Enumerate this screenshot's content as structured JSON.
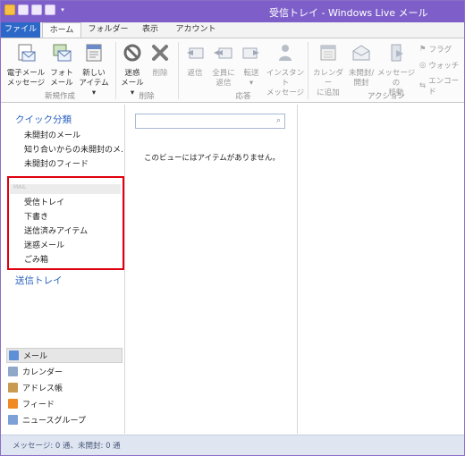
{
  "window": {
    "title": "受信トレイ - Windows Live メール"
  },
  "quick_access": {
    "caret": "▾"
  },
  "tabs": [
    {
      "label": "ファイル"
    },
    {
      "label": "ホーム"
    },
    {
      "label": "フォルダー"
    },
    {
      "label": "表示"
    },
    {
      "label": "アカウント"
    }
  ],
  "ribbon": {
    "new": {
      "email": [
        "電子メール",
        "メッセージ"
      ],
      "photo": [
        "フォト",
        "メール"
      ],
      "items": [
        "新しい",
        "アイテム ▾"
      ],
      "group": "新規作成"
    },
    "delete": {
      "junk": [
        "迷惑",
        "メール ▾"
      ],
      "delete": "削除",
      "group": "削除"
    },
    "respond": {
      "reply": "返信",
      "reply_all": [
        "全員に",
        "返信"
      ],
      "forward": [
        "転送",
        "▾"
      ],
      "instant": [
        "インスタント",
        "メッセージ"
      ],
      "group": "応答"
    },
    "actions": {
      "calendar": [
        "カレンダー",
        "に追加"
      ],
      "unread": [
        "未開封/",
        "開封"
      ],
      "move": [
        "メッセージの",
        "移動"
      ],
      "flag": "フラグ",
      "watch": "ウォッチ",
      "encode": "エンコード",
      "group": "アクション"
    }
  },
  "nav": {
    "quick_views": {
      "heading": "クイック分類",
      "items": [
        "未開封のメール",
        "知り合いからの未開封のメ…",
        "未開封のフィード"
      ]
    },
    "account": {
      "name": "MAIL",
      "folders": [
        "受信トレイ",
        "下書き",
        "送信済みアイテム",
        "迷惑メール",
        "ごみ箱"
      ]
    },
    "outbox": "送信トレイ",
    "modules": [
      "メール",
      "カレンダー",
      "アドレス帳",
      "フィード",
      "ニュースグループ"
    ]
  },
  "list": {
    "search": {
      "placeholder": "",
      "icon": "search-icon"
    },
    "empty_message": "このビューにはアイテムがありません。"
  },
  "status": {
    "text": "メッセージ: 0 通、未開封: 0 通"
  },
  "colors": {
    "title_bar": "#7e5fc9",
    "file_tab": "#2c68c8",
    "accent_text": "#2a62c0",
    "highlight_border": "#e0000f",
    "status_bar": "#dfe6f2"
  }
}
